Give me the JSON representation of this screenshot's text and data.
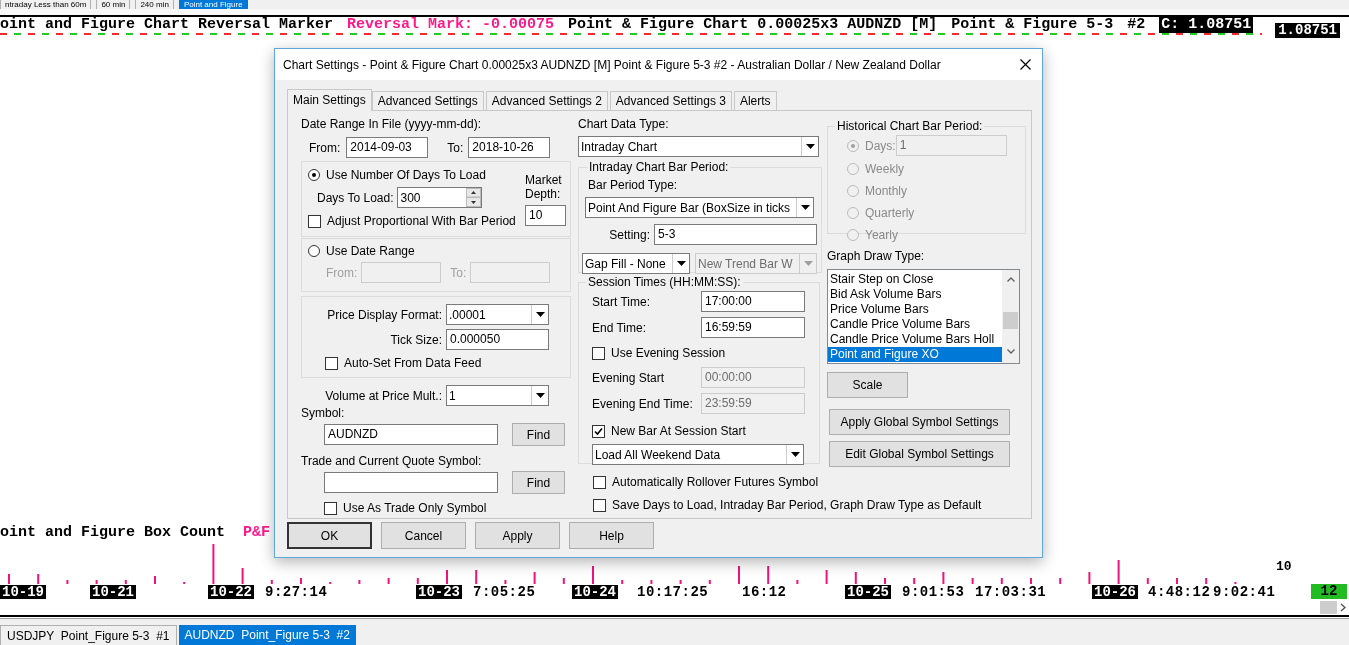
{
  "top_tabs": [
    {
      "label": "ntraday Less than 60m",
      "selected": false
    },
    {
      "label": "60 min",
      "selected": false
    },
    {
      "label": "240 min",
      "selected": false
    },
    {
      "label": "Point and Figure",
      "selected": true
    }
  ],
  "chart_header": {
    "segments": [
      {
        "text": "oint and Figure Chart Reversal Marker",
        "kind": "plain"
      },
      {
        "text": "Reversal Mark: -0.00075",
        "kind": "highlight"
      },
      {
        "text": "Point & Figure Chart 0.00025x3 AUDNZD [M]",
        "kind": "plain"
      },
      {
        "text": "Point & Figure 5-3",
        "kind": "plain"
      },
      {
        "text": "#2",
        "kind": "plain"
      },
      {
        "text": "C: 1.08751",
        "kind": "inverse"
      }
    ],
    "price_label": "1.08751"
  },
  "indicator": {
    "title": "oint and Figure Box Count",
    "tag": "P&F",
    "value_label": "10"
  },
  "time_axis": [
    {
      "text": "10-19",
      "kind": "date"
    },
    {
      "text": "10-21",
      "kind": "date"
    },
    {
      "text": "10-22",
      "kind": "date"
    },
    {
      "text": "9:27:14",
      "kind": "time"
    },
    {
      "text": "10-23",
      "kind": "date"
    },
    {
      "text": "7:05:25",
      "kind": "time"
    },
    {
      "text": "10-24",
      "kind": "date"
    },
    {
      "text": "10:17:25",
      "kind": "time"
    },
    {
      "text": "16:12",
      "kind": "time"
    },
    {
      "text": "10-25",
      "kind": "date"
    },
    {
      "text": "9:01:53",
      "kind": "time"
    },
    {
      "text": "17:03:31",
      "kind": "time"
    },
    {
      "text": "10-26",
      "kind": "date"
    },
    {
      "text": "4:48:12",
      "kind": "time"
    },
    {
      "text": "9:02:41",
      "kind": "time"
    }
  ],
  "axis_badge": "12",
  "bottom_tabs": [
    {
      "label": "USDJPY  Point_Figure 5-3  #1",
      "selected": false
    },
    {
      "label": "AUDNZD  Point_Figure 5-3  #2",
      "selected": true
    }
  ],
  "dialog": {
    "title": "Chart Settings - Point & Figure Chart 0.00025x3 AUDNZD [M]  Point & Figure 5-3  #2 - Australian Dollar / New Zealand Dollar",
    "tabs": [
      {
        "label": "Main Settings",
        "selected": true
      },
      {
        "label": "Advanced Settings",
        "selected": false
      },
      {
        "label": "Advanced Settings 2",
        "selected": false
      },
      {
        "label": "Advanced Settings 3",
        "selected": false
      },
      {
        "label": "Alerts",
        "selected": false
      }
    ],
    "date_range": {
      "label": "Date Range In File (yyyy-mm-dd):",
      "from_label": "From:",
      "from": "2014-09-03",
      "to_label": "To:",
      "to": "2018-10-26"
    },
    "days_group": {
      "radio": {
        "label": "Use Number Of Days To Load",
        "selected": true
      },
      "days_label": "Days To Load:",
      "days": "300",
      "adjust": {
        "label": "Adjust Proportional With Bar Period",
        "checked": false
      },
      "depth_label": "Market Depth:",
      "depth": "10"
    },
    "range_group": {
      "radio": {
        "label": "Use Date Range",
        "selected": false
      },
      "from_label": "From:",
      "to_label": "To:"
    },
    "format_group": {
      "format_label": "Price Display Format:",
      "format": ".00001",
      "tick_label": "Tick Size:",
      "tick": "0.000050",
      "auto_set": {
        "label": "Auto-Set From Data Feed",
        "checked": false
      }
    },
    "volume": {
      "label": "Volume at Price Mult.:",
      "value": "1"
    },
    "symbol": {
      "label": "Symbol:",
      "value": "AUDNZD",
      "button": "Find"
    },
    "quote_symbol": {
      "label": "Trade and Current Quote Symbol:",
      "button": "Find"
    },
    "trade_only": {
      "label": "Use As Trade Only Symbol",
      "checked": false
    },
    "data_type": {
      "label": "Chart Data Type:",
      "value": "Intraday Chart"
    },
    "intraday_group": {
      "title": "Intraday Chart Bar Period:",
      "type_label": "Bar Period Type:",
      "type": "Point And Figure Bar (BoxSize in ticks",
      "setting_label": "Setting:",
      "setting": "5-3",
      "gap_fill": "Gap Fill - None",
      "new_trend": {
        "value": "New Trend Bar W",
        "disabled": true
      }
    },
    "session_group": {
      "title": "Session Times (HH:MM:SS):",
      "start_label": "Start Time:",
      "start": "17:00:00",
      "end_label": "End Time:",
      "end": "16:59:59",
      "evening": {
        "label": "Use Evening Session",
        "checked": false
      },
      "evening_start_label": "Evening Start",
      "evening_start": "00:00:00",
      "evening_end_label": "Evening End Time:",
      "evening_end": "23:59:59",
      "new_bar": {
        "label": "New Bar At Session Start",
        "checked": true
      },
      "weekend": "Load All Weekend Data"
    },
    "historical_group": {
      "title": "Historical Chart Bar Period:",
      "disabled": true,
      "days": "1",
      "options": [
        {
          "label": "Days:",
          "selected": true
        },
        {
          "label": "Weekly",
          "selected": false
        },
        {
          "label": "Monthly",
          "selected": false
        },
        {
          "label": "Quarterly",
          "selected": false
        },
        {
          "label": "Yearly",
          "selected": false
        }
      ]
    },
    "draw_type": {
      "label": "Graph Draw Type:",
      "items": [
        {
          "label": "Stair Step on Close",
          "selected": false
        },
        {
          "label": "Bid Ask Volume Bars",
          "selected": false
        },
        {
          "label": "Price Volume Bars",
          "selected": false
        },
        {
          "label": "Candle Price Volume Bars",
          "selected": false
        },
        {
          "label": "Candle Price Volume Bars Holl",
          "selected": false
        },
        {
          "label": "Point and Figure XO",
          "selected": true
        }
      ]
    },
    "scale_button": "Scale",
    "global_buttons": [
      "Apply Global Symbol Settings",
      "Edit Global Symbol Settings"
    ],
    "rollover": {
      "label": "Automatically Rollover Futures Symbol",
      "checked": false
    },
    "save_default": {
      "label": "Save Days to Load, Intraday Bar Period, Graph Draw Type as Default",
      "checked": false
    },
    "buttons": [
      "OK",
      "Cancel",
      "Apply",
      "Help"
    ]
  }
}
